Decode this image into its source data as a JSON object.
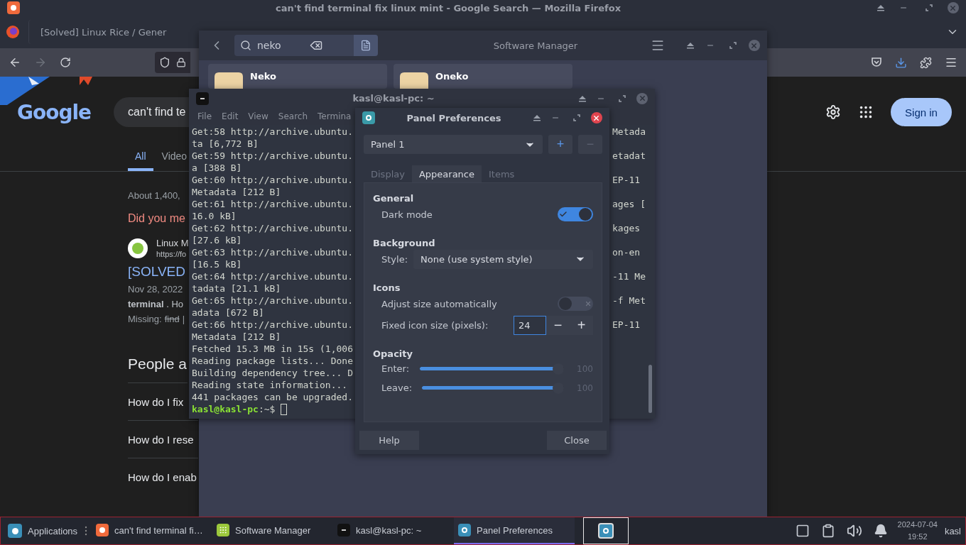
{
  "firefox": {
    "title": "can't find terminal fix linux mint - Google Search — Mozilla Firefox",
    "tabs": [
      {
        "label": "[Solved] Linux Rice / Gener",
        "selected": false
      }
    ],
    "forward_disabled": true
  },
  "google": {
    "logo": "Google",
    "search_value": "can't find te",
    "sign_in": "Sign in",
    "tabs": [
      {
        "label": "All",
        "selected": true
      },
      {
        "label": "Video",
        "selected": false
      }
    ],
    "result_count": "About 1,400,",
    "did_you_mean": "Did you me",
    "result": {
      "site": "Linux M",
      "url": "https://fo",
      "title": "[SOLVED",
      "date": "Nov 28, 2022",
      "snippet": "**terminal** . Ho",
      "missing_label": "Missing:",
      "missing_word": "find",
      "missing_rest": "|"
    },
    "people_also_ask": "People a",
    "questions": [
      "How do I fix",
      "How do I rese",
      "How do I enab"
    ]
  },
  "software_manager": {
    "title": "Software Manager",
    "search": "neko",
    "results": [
      {
        "name": "Neko"
      },
      {
        "name": "Oneko"
      }
    ]
  },
  "terminal": {
    "title": "kasl@kasl-pc: ~",
    "menu": [
      "File",
      "Edit",
      "View",
      "Search",
      "Termina"
    ],
    "lines": [
      "Get:58 http://archive.ubuntu.",
      "ta [6,772 B]",
      "Get:59 http://archive.ubuntu.",
      "a [388 B]",
      "Get:60 http://archive.ubuntu.",
      "Metadata [212 B]",
      "Get:61 http://archive.ubuntu.",
      "16.0 kB]",
      "Get:62 http://archive.ubuntu.",
      "[27.6 kB]",
      "Get:63 http://archive.ubuntu.",
      "[16.5 kB]",
      "Get:64 http://archive.ubuntu.",
      "tadata [21.1 kB]",
      "Get:65 http://archive.ubuntu.",
      "adata [672 B]",
      "Get:66 http://archive.ubuntu.",
      "Metadata [212 B]",
      "Fetched 15.3 MB in 15s (1,006",
      "Reading package lists... Done",
      "Building dependency tree... D",
      "Reading state information...",
      "441 packages can be upgraded."
    ],
    "right_fragments": [
      "Metada",
      "etadat",
      "EP-11",
      "ages [",
      "kages",
      "on-en",
      "-11 Me",
      "-f Met",
      "EP-11"
    ],
    "prompt_user": "kasl@kasl-pc",
    "prompt_path": ":~$"
  },
  "panel_preferences": {
    "title": "Panel Preferences",
    "panel": "Panel 1",
    "panel_buttons": [
      {
        "label": "+",
        "disabled": false
      },
      {
        "label": "−",
        "disabled": true
      }
    ],
    "tabs": [
      {
        "label": "Display",
        "selected": false
      },
      {
        "label": "Appearance",
        "selected": true
      },
      {
        "label": "Items",
        "selected": false
      }
    ],
    "sections": [
      {
        "heading": "General",
        "rows": [
          {
            "kind": "toggle",
            "label": "Dark mode",
            "on": true
          }
        ]
      },
      {
        "heading": "Background",
        "rows": [
          {
            "kind": "select",
            "label": "Style:",
            "value": "None (use system style)"
          }
        ]
      },
      {
        "heading": "Icons",
        "rows": [
          {
            "kind": "toggle",
            "label": "Adjust size automatically",
            "on": false
          },
          {
            "kind": "spin",
            "label": "Fixed icon size (pixels):",
            "value": "24",
            "minus": "−",
            "plus": "+"
          }
        ]
      },
      {
        "heading": "Opacity",
        "rows": [
          {
            "kind": "slider",
            "label": "Enter:",
            "level": 1,
            "reading": "100"
          },
          {
            "kind": "slider",
            "label": "Leave:",
            "level": 1,
            "reading": "100"
          }
        ]
      }
    ],
    "buttons": [
      "Help",
      "Close"
    ]
  },
  "taskbar": {
    "start": "Applications",
    "items": [
      {
        "kind": "browser",
        "label": "can't find terminal fi…",
        "selected": false
      },
      {
        "kind": "software",
        "label": "Software Manager",
        "selected": false
      },
      {
        "kind": "terminal",
        "label": "kasl@kasl-pc: ~",
        "selected": false
      },
      {
        "kind": "prefs",
        "label": "Panel Preferences",
        "selected": true
      }
    ],
    "date": "2024-07-04",
    "time": "19:52",
    "user": "kasl"
  }
}
